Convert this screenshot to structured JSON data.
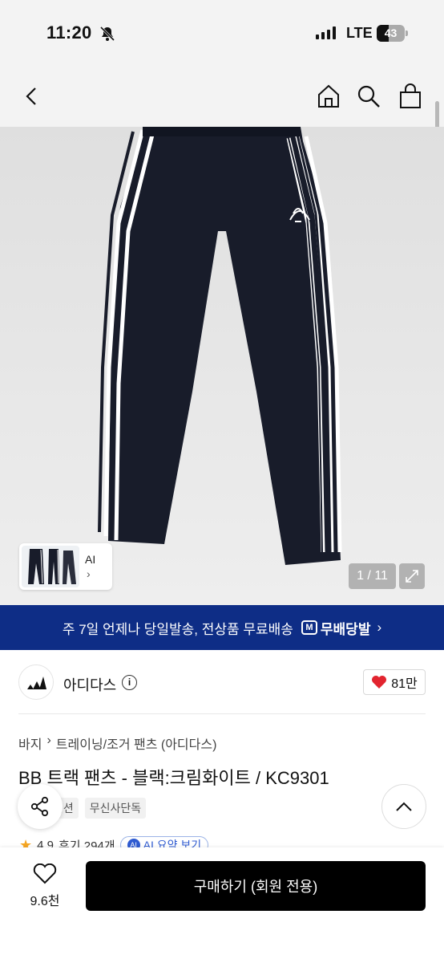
{
  "status_bar": {
    "time": "11:20",
    "network": "LTE",
    "battery": "43",
    "battery_level": 0.43
  },
  "header": {
    "back_icon": "back-arrow-icon",
    "home_icon": "home-icon",
    "search_icon": "search-icon",
    "cart_icon": "shopping-bag-icon"
  },
  "gallery": {
    "counter": "1 / 11",
    "thumbnail_label": "AI",
    "thumbnail_chevron": "›"
  },
  "promo": {
    "text": "주 7일 언제나 당일발송, 전상품 무료배송",
    "badge_mark": "M",
    "badge_label": "무배당발",
    "chevron": "›"
  },
  "brand": {
    "name": "아디다스",
    "info": "i",
    "likes": "81만"
  },
  "breadcrumb": {
    "items": [
      "바지",
      "트레이닝/조거 팬츠 (아디다스)"
    ],
    "separator": "›"
  },
  "product": {
    "title": "BB 트랙 팬츠 - 블랙:크림화이트 / KC9301",
    "tags": [
      "디션",
      "무신사단독"
    ],
    "rating": "4.9",
    "reviews": "후기 294개",
    "ai_summary": "AI 요약 보기",
    "ai_mark": "AI"
  },
  "bottom_bar": {
    "wish_count": "9.6천",
    "buy_label": "구매하기 (회원 전용)"
  },
  "colors": {
    "promo_bg": "#0e2d86",
    "heart": "#e2242f",
    "buy_bg": "#000000"
  }
}
